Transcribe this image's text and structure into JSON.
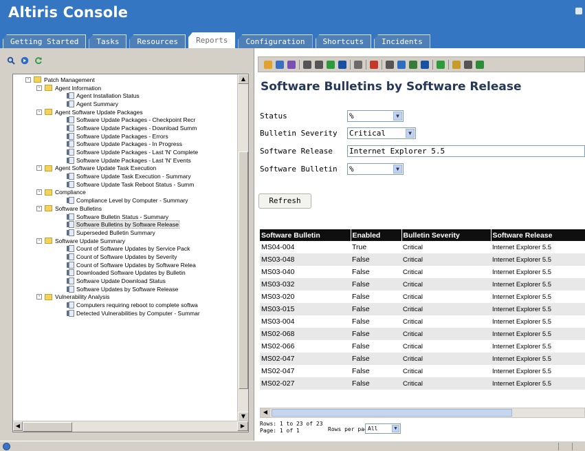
{
  "app": {
    "title": "Altiris Console"
  },
  "tabs": [
    {
      "label": "Getting Started",
      "active": false
    },
    {
      "label": "Tasks",
      "active": false
    },
    {
      "label": "Resources",
      "active": false
    },
    {
      "label": "Reports",
      "active": true
    },
    {
      "label": "Configuration",
      "active": false
    },
    {
      "label": "Shortcuts",
      "active": false
    },
    {
      "label": "Incidents",
      "active": false
    }
  ],
  "left_toolbar": {
    "icons": [
      "search-icon",
      "go-icon",
      "refresh-icon"
    ]
  },
  "tree": [
    {
      "label": "Patch Management",
      "level": 0,
      "type": "folder",
      "expander": "-"
    },
    {
      "label": "Agent Information",
      "level": 1,
      "type": "folder",
      "expander": "-"
    },
    {
      "label": "Agent Installation Status",
      "level": 2,
      "type": "report"
    },
    {
      "label": "Agent Summary",
      "level": 2,
      "type": "report"
    },
    {
      "label": "Agent Software Update Packages",
      "level": 1,
      "type": "folder",
      "expander": "-"
    },
    {
      "label": "Software Update Packages - Checkpoint Recr",
      "level": 2,
      "type": "report"
    },
    {
      "label": "Software Update Packages - Download Summ",
      "level": 2,
      "type": "report"
    },
    {
      "label": "Software Update Packages - Errors",
      "level": 2,
      "type": "report"
    },
    {
      "label": "Software Update Packages - In Progress",
      "level": 2,
      "type": "report"
    },
    {
      "label": "Software Update Packages - Last 'N' Complete",
      "level": 2,
      "type": "report"
    },
    {
      "label": "Software Update Packages - Last 'N' Events",
      "level": 2,
      "type": "report"
    },
    {
      "label": "Agent Software Update Task Execution",
      "level": 1,
      "type": "folder",
      "expander": "-"
    },
    {
      "label": "Software Update Task Execution - Summary",
      "level": 2,
      "type": "report"
    },
    {
      "label": "Software Update Task Reboot Status - Summ",
      "level": 2,
      "type": "report"
    },
    {
      "label": "Compliance",
      "level": 1,
      "type": "folder",
      "expander": "-"
    },
    {
      "label": "Compliance Level by Computer - Summary",
      "level": 2,
      "type": "report"
    },
    {
      "label": "Software Bulletins",
      "level": 1,
      "type": "folder",
      "expander": "-"
    },
    {
      "label": "Software Bulletin Status - Summary",
      "level": 2,
      "type": "report"
    },
    {
      "label": "Software Bulletins by Software Release",
      "level": 2,
      "type": "report",
      "selected": true
    },
    {
      "label": "Superseded Bulletin Summary",
      "level": 2,
      "type": "report"
    },
    {
      "label": "Software Update Summary",
      "level": 1,
      "type": "folder",
      "expander": "-"
    },
    {
      "label": "Count of Software Updates by Service Pack",
      "level": 2,
      "type": "report"
    },
    {
      "label": "Count of Software Updates by Severity",
      "level": 2,
      "type": "report"
    },
    {
      "label": "Count of Software Updates by Software Relea",
      "level": 2,
      "type": "report"
    },
    {
      "label": "Downloaded Software Updates by Bulletin",
      "level": 2,
      "type": "report"
    },
    {
      "label": "Software Update Download Status",
      "level": 2,
      "type": "report"
    },
    {
      "label": "Software Updates by Software Release",
      "level": 2,
      "type": "report"
    },
    {
      "label": "Vulnerability Analysis",
      "level": 1,
      "type": "folder",
      "expander": "-"
    },
    {
      "label": "Computers requiring reboot to complete softwa",
      "level": 2,
      "type": "report"
    },
    {
      "label": "Detected Vulnerabilities by Computer - Summar",
      "level": 2,
      "type": "report"
    }
  ],
  "scroll": {
    "up": "▲",
    "down": "▼",
    "left": "◀",
    "right": "▶"
  },
  "right_toolbar": {
    "icons": [
      "wizard-icon",
      "chart-icon",
      "edit-icon",
      "sep",
      "code-icon",
      "move-icon",
      "save-icon",
      "print-icon",
      "sep",
      "help-icon",
      "sep",
      "table-icon",
      "sep",
      "find-icon",
      "zoom-icon",
      "refresh-icon",
      "mail-icon",
      "sep",
      "schedule-icon",
      "sep",
      "play-icon",
      "export-icon",
      "more-icon"
    ]
  },
  "report": {
    "title": "Software Bulletins by Software Release",
    "filters": [
      {
        "label": "Status",
        "value": "%",
        "dropdown": true
      },
      {
        "label": "Bulletin Severity",
        "value": "Critical",
        "dropdown": true
      },
      {
        "label": "Software Release",
        "value": "Internet Explorer 5.5",
        "dropdown": false
      },
      {
        "label": "Software Bulletin",
        "value": "%",
        "dropdown": true
      }
    ],
    "refresh_label": "Refresh",
    "columns": [
      "Software Bulletin",
      "Enabled",
      "Bulletin Severity",
      "Software Release"
    ],
    "rows": [
      [
        "MS04-004",
        "True",
        "Critical",
        "Internet Explorer 5.5"
      ],
      [
        "MS03-048",
        "False",
        "Critical",
        "Internet Explorer 5.5"
      ],
      [
        "MS03-040",
        "False",
        "Critical",
        "Internet Explorer 5.5"
      ],
      [
        "MS03-032",
        "False",
        "Critical",
        "Internet Explorer 5.5"
      ],
      [
        "MS03-020",
        "False",
        "Critical",
        "Internet Explorer 5.5"
      ],
      [
        "MS03-015",
        "False",
        "Critical",
        "Internet Explorer 5.5"
      ],
      [
        "MS03-004",
        "False",
        "Critical",
        "Internet Explorer 5.5"
      ],
      [
        "MS02-068",
        "False",
        "Critical",
        "Internet Explorer 5.5"
      ],
      [
        "MS02-066",
        "False",
        "Critical",
        "Internet Explorer 5.5"
      ],
      [
        "MS02-047",
        "False",
        "Critical",
        "Internet Explorer 5.5"
      ],
      [
        "MS02-047",
        "False",
        "Critical",
        "Internet Explorer 5.5"
      ],
      [
        "MS02-027",
        "False",
        "Critical",
        "Internet Explorer 5.5"
      ]
    ],
    "paging": {
      "rows": "Rows:  1 to 23 of 23",
      "page": "Page:  1 of 1",
      "rows_per_page_label": "Rows per page:",
      "rows_per_page_value": "All"
    }
  },
  "colors": {
    "header_bg": "#3476c2",
    "tab_bg": "#4e7fb6",
    "grid_header_bg": "#0f0f0f",
    "title_color": "#253858"
  }
}
